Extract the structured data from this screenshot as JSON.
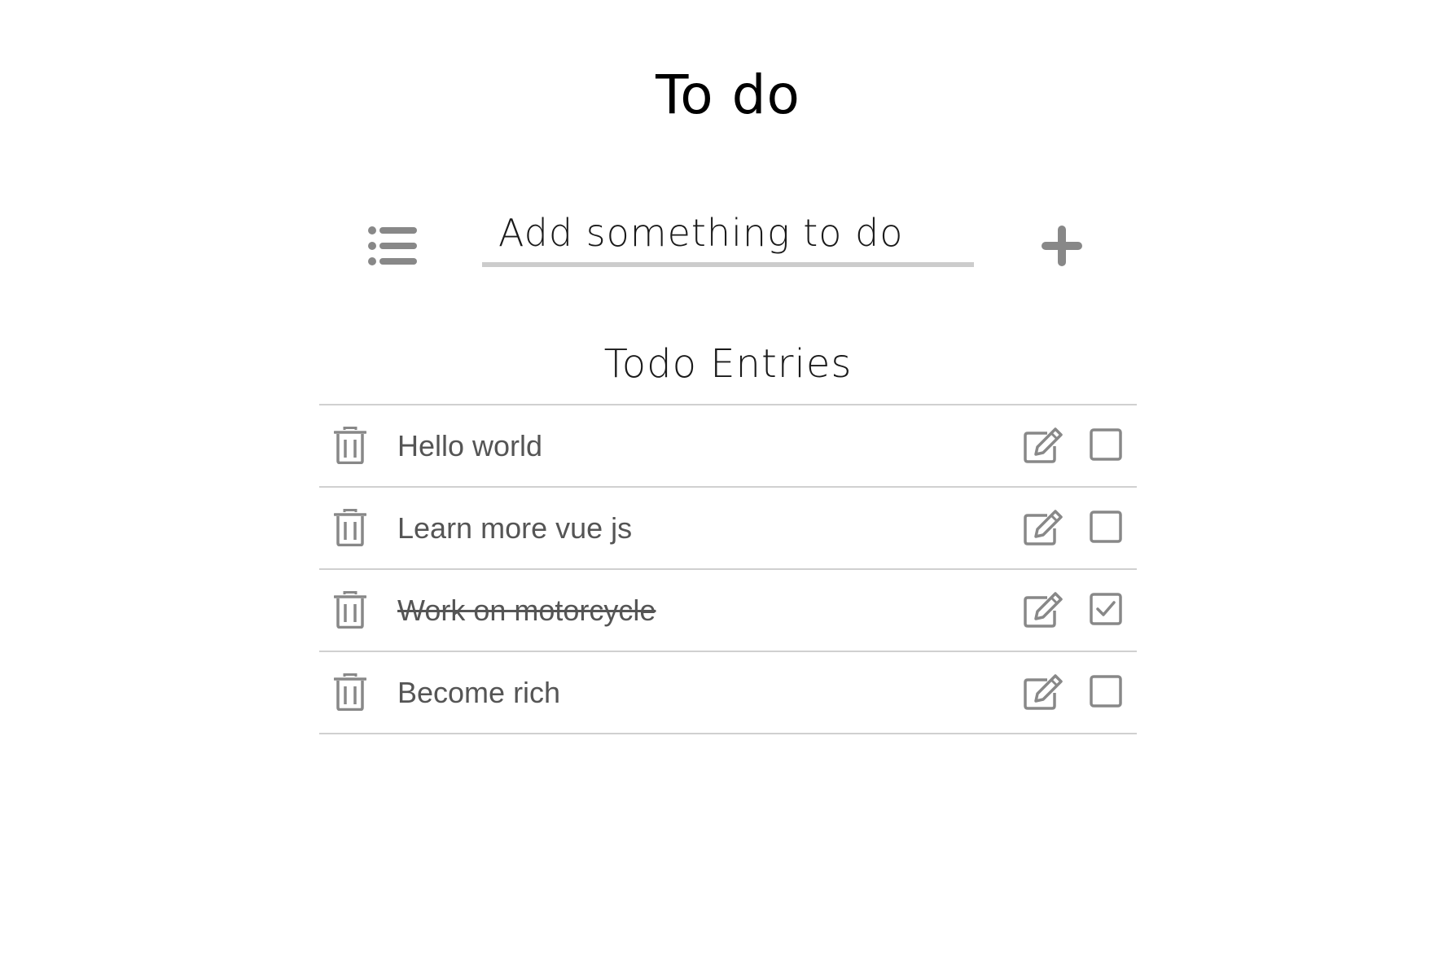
{
  "header": {
    "title": "To do"
  },
  "add_form": {
    "placeholder": "Add something to do",
    "list_icon": "list-icon",
    "add_icon": "plus-icon"
  },
  "entries_section": {
    "title": "Todo Entries"
  },
  "todos": [
    {
      "text": "Hello world",
      "completed": false
    },
    {
      "text": "Learn more vue js",
      "completed": false
    },
    {
      "text": "Work on motorcycle",
      "completed": true
    },
    {
      "text": "Become rich",
      "completed": false
    }
  ],
  "icons": {
    "delete": "trash-icon",
    "edit": "edit-icon",
    "checkbox": "checkbox-icon"
  },
  "colors": {
    "icon_gray": "#888888",
    "text_gray": "#555555",
    "divider": "#d0d0d0",
    "input_underline": "#cccccc"
  }
}
